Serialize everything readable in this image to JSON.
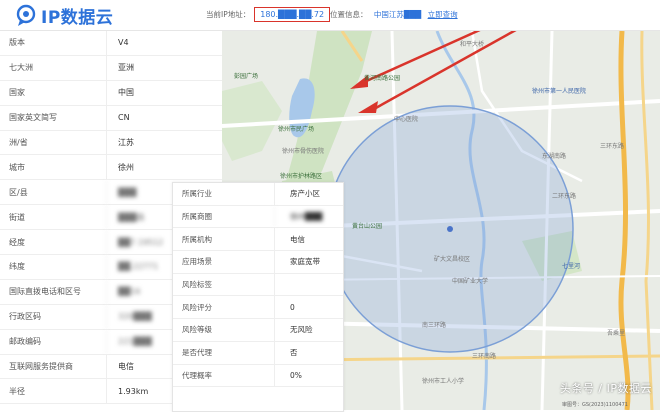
{
  "header": {
    "logo_text": "IP数据云",
    "ip_label": "当前IP地址：",
    "ip_value": "180.███.██.72",
    "location_label": "位置信息：",
    "location_value": "中国江苏███",
    "location_link": "立即查询"
  },
  "table": [
    {
      "label": "版本",
      "value": "V4",
      "blur": false
    },
    {
      "label": "七大洲",
      "value": "亚洲",
      "blur": false
    },
    {
      "label": "国家",
      "value": "中国",
      "blur": false
    },
    {
      "label": "国家英文简写",
      "value": "CN",
      "blur": false
    },
    {
      "label": "洲/省",
      "value": "江苏",
      "blur": false
    },
    {
      "label": "城市",
      "value": "徐州",
      "blur": false
    },
    {
      "label": "区/县",
      "value": "███",
      "blur": true
    },
    {
      "label": "街道",
      "value": "███路",
      "blur": true
    },
    {
      "label": "经度",
      "value": "██7.19512",
      "blur": true
    },
    {
      "label": "纬度",
      "value": "██.22771",
      "blur": true
    },
    {
      "label": "国际直拨电话和区号",
      "value": "██16",
      "blur": true
    },
    {
      "label": "行政区码",
      "value": "320███",
      "blur": true
    },
    {
      "label": "邮政编码",
      "value": "221███",
      "blur": true
    },
    {
      "label": "互联网服务提供商",
      "value": "电信",
      "blur": false
    },
    {
      "label": "半径",
      "value": "1.93km",
      "blur": false
    }
  ],
  "overlay": [
    {
      "label": "所属行业",
      "value": "房产小区"
    },
    {
      "label": "所属商圈",
      "value": "徐州███"
    },
    {
      "label": "所属机构",
      "value": "电信"
    },
    {
      "label": "应用场景",
      "value": "家庭宽带"
    },
    {
      "label": "风险标签",
      "value": ""
    },
    {
      "label": "风险评分",
      "value": "0"
    },
    {
      "label": "风险等级",
      "value": "无风险"
    },
    {
      "label": "是否代理",
      "value": "否"
    },
    {
      "label": "代理概率",
      "value": "0%"
    }
  ],
  "map": {
    "labels": {
      "l1": "黄河南路公园",
      "l2": "彭园广场",
      "l3": "中心医院",
      "l4": "徐州市民广场",
      "l5": "徐州市护林路区",
      "l6": "黄台山公园",
      "l7": "徐州市骨伤医院",
      "l8": "中国矿业大学",
      "l9": "南三环路",
      "l10": "东湖南路",
      "l11": "三环东路",
      "l12": "二环东路",
      "l13": "和平大桥",
      "l14": "徐州市第一人民医院",
      "l15": "七里河",
      "l16": "吾乘里",
      "l17": "徐州市工人小学",
      "l18": "矿大文昌校区",
      "l19": "三环南路"
    },
    "scale": "审图号：GS(2023)1100471",
    "colors": {
      "circle": "#7b9fd6",
      "arrow": "#d9342b",
      "water": "#a8c8ea",
      "green": "#cfe3c2"
    }
  },
  "watermark": "头条号 / IP数据云"
}
